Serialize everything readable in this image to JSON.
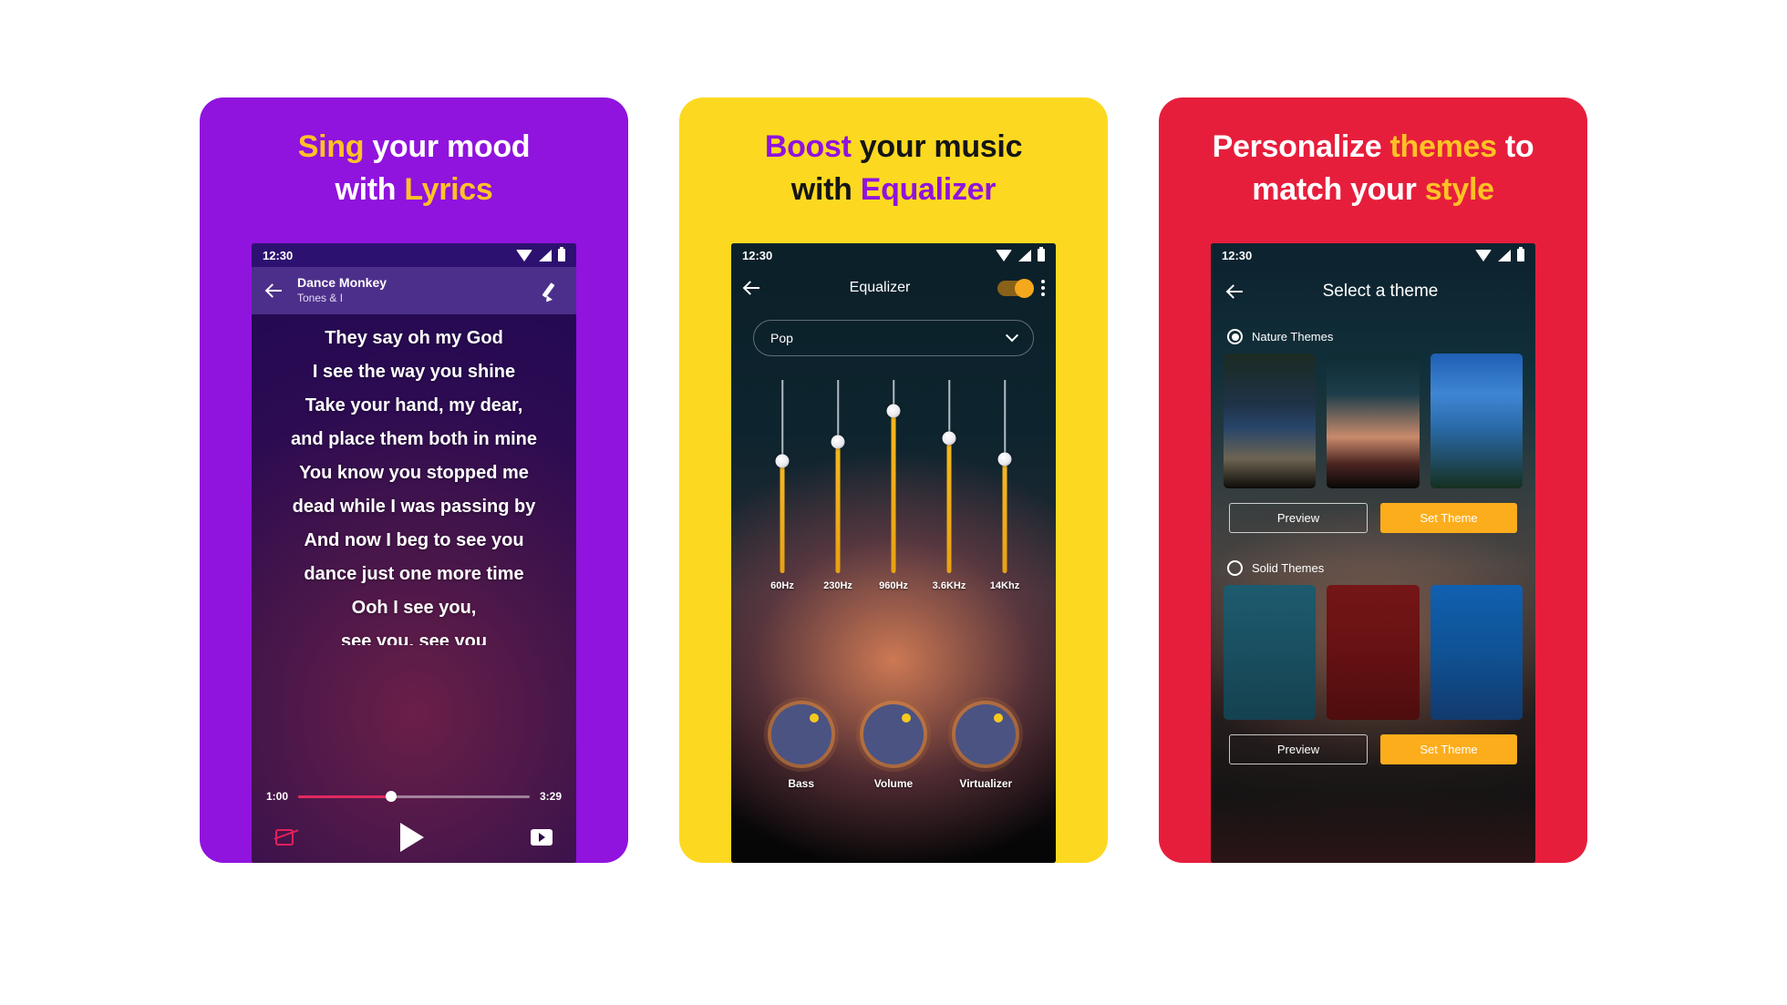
{
  "panels": [
    {
      "theme_color": "#9013de",
      "headline": {
        "line1_a": "Sing",
        "line1_b": " your mood",
        "line2_a": "with ",
        "line2_b": "Lyrics"
      }
    },
    {
      "theme_color": "#fcd920",
      "headline": {
        "line1_a": "Boost",
        "line1_b": " your music",
        "line2_a": "with ",
        "line2_b": "Equalizer"
      }
    },
    {
      "theme_color": "#e61e3c",
      "headline": {
        "line1_a": "Personalize ",
        "line1_b": "themes",
        "line1_c": " to",
        "line2_a": "match your ",
        "line2_b": "style"
      }
    }
  ],
  "status_bar": {
    "time": "12:30",
    "wifi_icon": "wifi-icon",
    "signal_icon": "signal-icon",
    "battery_icon": "battery-icon"
  },
  "lyrics_screen": {
    "back_icon": "arrow-back-icon",
    "song_title": "Dance Monkey",
    "artist": "Tones & I",
    "edit_icon": "pencil-icon",
    "lines": [
      "They say oh my God",
      "I see the way you shine",
      "Take your hand, my dear,",
      "and place them both in mine",
      "You know you stopped me",
      "dead while I was passing by",
      "And now I beg to see you",
      "dance just one more time",
      "Ooh I see you,",
      "see you, see you"
    ],
    "current_time": "1:00",
    "total_time": "3:29",
    "progress_percent": 40,
    "repeat_icon": "repeat-icon",
    "play_icon": "play-icon",
    "video_icon": "video-icon"
  },
  "equalizer_screen": {
    "back_icon": "arrow-back-icon",
    "title": "Equalizer",
    "toggle_state": "on",
    "toggle_icon": "toggle-switch-icon",
    "overflow_icon": "kebab-menu-icon",
    "preset": "Pop",
    "preset_chevron_icon": "chevron-down-icon",
    "bands": [
      {
        "label": "60Hz",
        "value_percent": 58
      },
      {
        "label": "230Hz",
        "value_percent": 68
      },
      {
        "label": "960Hz",
        "value_percent": 84
      },
      {
        "label": "3.6KHz",
        "value_percent": 70
      },
      {
        "label": "14Khz",
        "value_percent": 59
      }
    ],
    "knobs": [
      {
        "label": "Bass"
      },
      {
        "label": "Volume"
      },
      {
        "label": "Virtualizer"
      }
    ]
  },
  "themes_screen": {
    "back_icon": "arrow-back-icon",
    "title": "Select a theme",
    "sections": [
      {
        "label": "Nature Themes",
        "selected": true,
        "thumbnails": [
          "nature-night-field",
          "nature-sunset-clouds",
          "nature-blue-sky"
        ],
        "preview_label": "Preview",
        "set_theme_label": "Set Theme"
      },
      {
        "label": "Solid Themes",
        "selected": false,
        "thumbnails": [
          "solid-teal",
          "solid-dark-red",
          "solid-blue"
        ],
        "preview_label": "Preview",
        "set_theme_label": "Set Theme"
      }
    ]
  }
}
